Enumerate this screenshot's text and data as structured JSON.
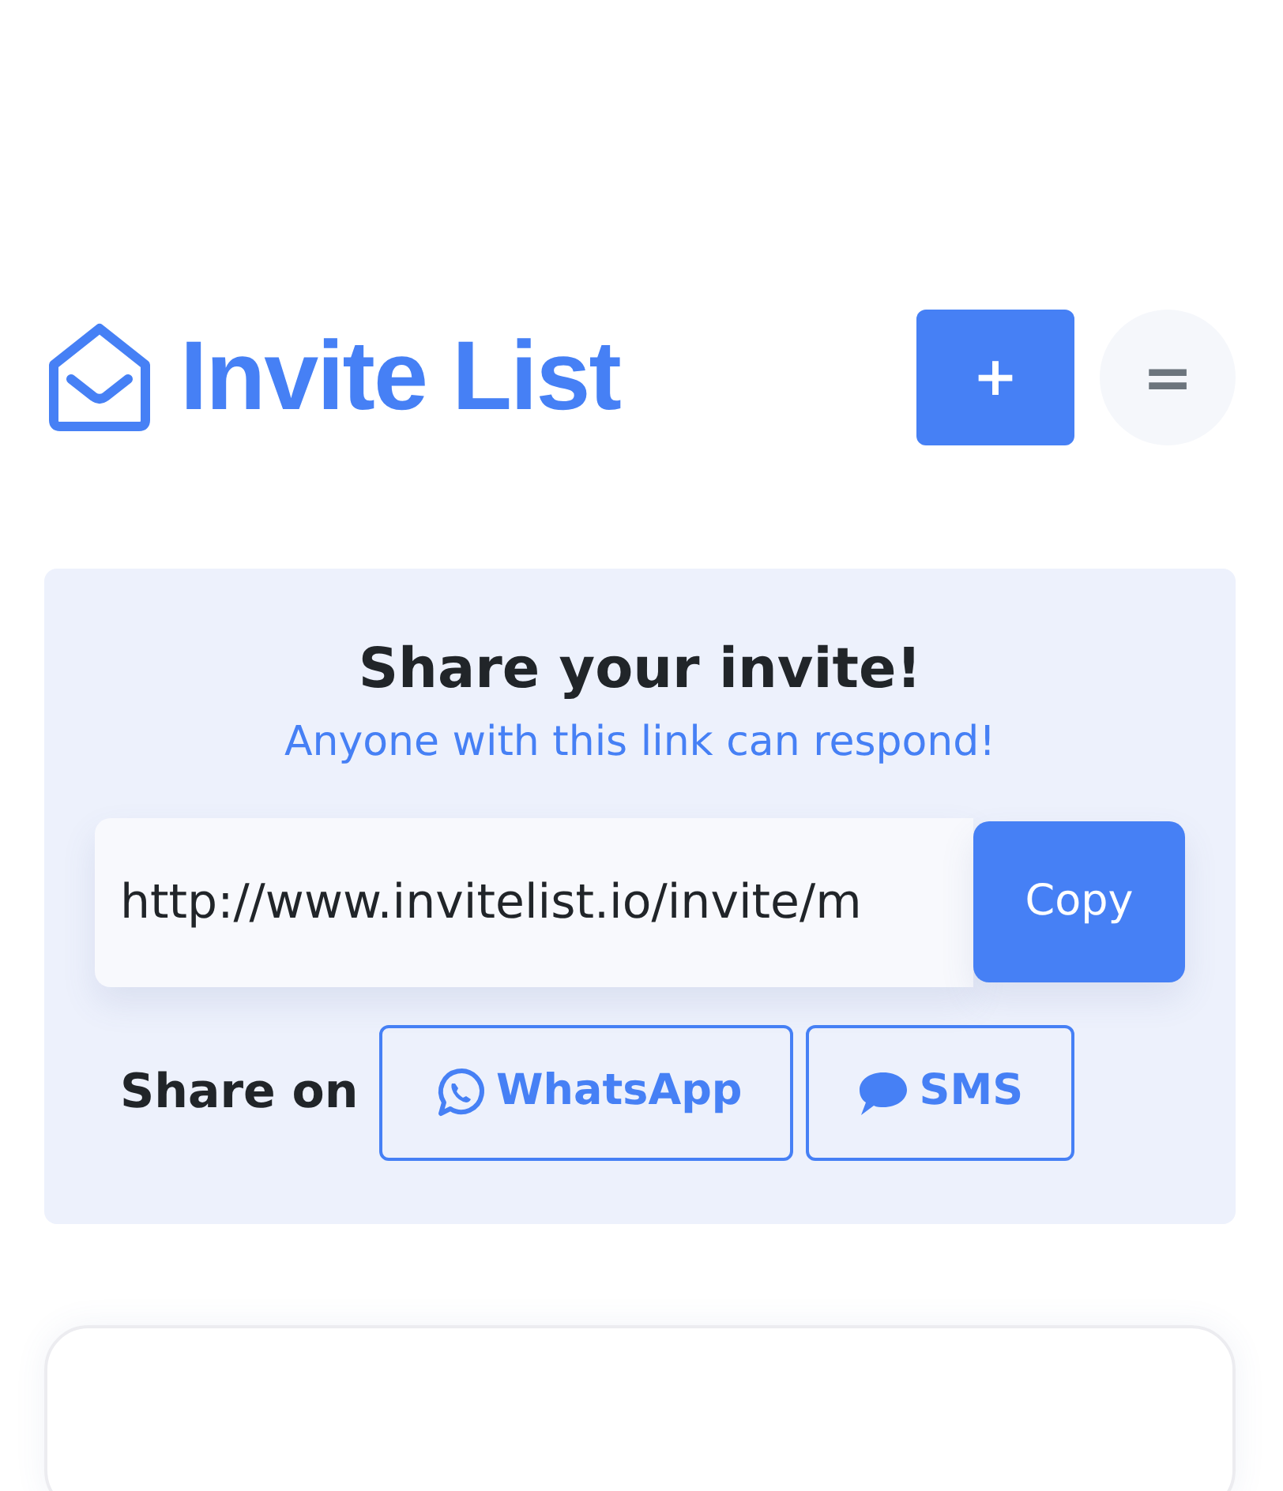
{
  "header": {
    "title": "Invite List",
    "add_button": "+",
    "menu_button": "="
  },
  "share": {
    "title": "Share your invite!",
    "subtitle": "Anyone with this link can respond!",
    "link": "http://www.invitelist.io/invite/m",
    "copy_button": "Copy",
    "share_label": "Share on",
    "channels": [
      {
        "kind": "whatsapp",
        "label": "WhatsApp"
      },
      {
        "kind": "sms",
        "label": "SMS"
      }
    ]
  }
}
